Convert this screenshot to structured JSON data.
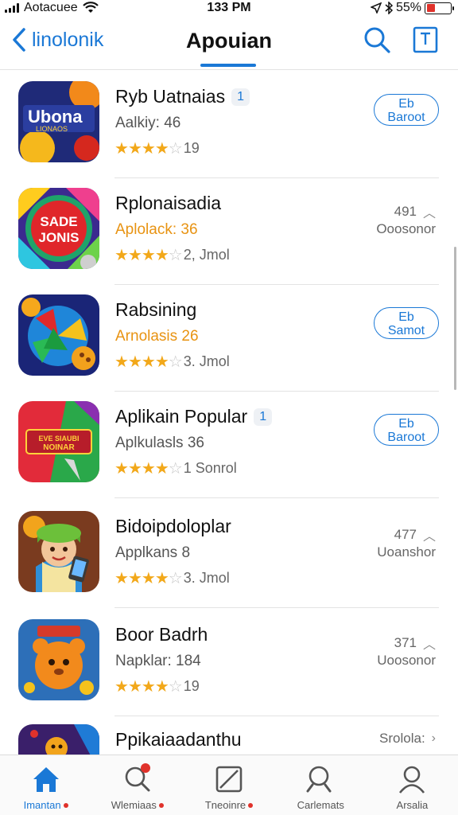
{
  "status_bar": {
    "carrier": "Aotacuee",
    "time": "133 PM",
    "battery": "55%",
    "battery_level": 0.35
  },
  "header": {
    "back_label": "linolonik",
    "title": "Apouian"
  },
  "apps": [
    {
      "name": "Ryb Uatnaias",
      "badge": "1",
      "subtitle": "Aalkiy: 46",
      "subtitle_orange": false,
      "rating": 3.5,
      "rating_text": "19",
      "button": "Eb\nBaroot",
      "meta_count": "",
      "meta_sub": "",
      "icon": "game-icon-1"
    },
    {
      "name": "Rplonaisadia",
      "badge": "",
      "subtitle": "Aplolack: 36",
      "subtitle_orange": true,
      "rating": 4,
      "rating_text": "2, Jmol",
      "button": "",
      "meta_count": "491",
      "meta_sub": "Ooosonor",
      "icon": "game-icon-2"
    },
    {
      "name": "Rabsining",
      "badge": "",
      "subtitle": "Arnolasis 26",
      "subtitle_orange": true,
      "rating": 4,
      "rating_text": "3. Jmol",
      "button": "Eb\nSamot",
      "meta_count": "",
      "meta_sub": "",
      "icon": "game-icon-3"
    },
    {
      "name": "Aplikain Popular",
      "badge": "1",
      "subtitle": "Aplkulasls 36",
      "subtitle_orange": false,
      "rating": 4,
      "rating_text": "1 Sonrol",
      "button": "Eb\nBaroot",
      "meta_count": "",
      "meta_sub": "",
      "icon": "game-icon-4"
    },
    {
      "name": "Bidoipdoloplar",
      "badge": "",
      "subtitle": "Applkans 8",
      "subtitle_orange": false,
      "rating": 4,
      "rating_text": "3. Jmol",
      "button": "",
      "meta_count": "477",
      "meta_sub": "Uoanshor",
      "icon": "game-icon-5"
    },
    {
      "name": "Boor Badrh",
      "badge": "",
      "subtitle": "Napklar: 184",
      "subtitle_orange": false,
      "rating": 3.5,
      "rating_text": "19",
      "button": "",
      "meta_count": "371",
      "meta_sub": "Uoosonor",
      "icon": "game-icon-6"
    },
    {
      "name": "Ppikaiaadanthu",
      "badge": "",
      "subtitle": "",
      "subtitle_orange": false,
      "rating": 0,
      "rating_text": "",
      "button": "",
      "meta_count": "Srolola:",
      "meta_sub": "",
      "icon": "game-icon-7"
    }
  ],
  "tabs": [
    {
      "label": "Imantan",
      "icon": "home-icon",
      "dot": true,
      "active": true
    },
    {
      "label": "Wlemiaas",
      "icon": "search-icon",
      "dot": true,
      "active": false
    },
    {
      "label": "Tneoinre",
      "icon": "square-slash-icon",
      "dot": true,
      "active": false
    },
    {
      "label": "Carlemats",
      "icon": "search-icon",
      "dot": false,
      "active": false
    },
    {
      "label": "Arsalia",
      "icon": "person-icon",
      "dot": false,
      "active": false
    }
  ],
  "colors": {
    "accent": "#1a78d6",
    "star": "#f2a81a",
    "orange_text": "#e89312",
    "badge_red": "#e0322b"
  }
}
